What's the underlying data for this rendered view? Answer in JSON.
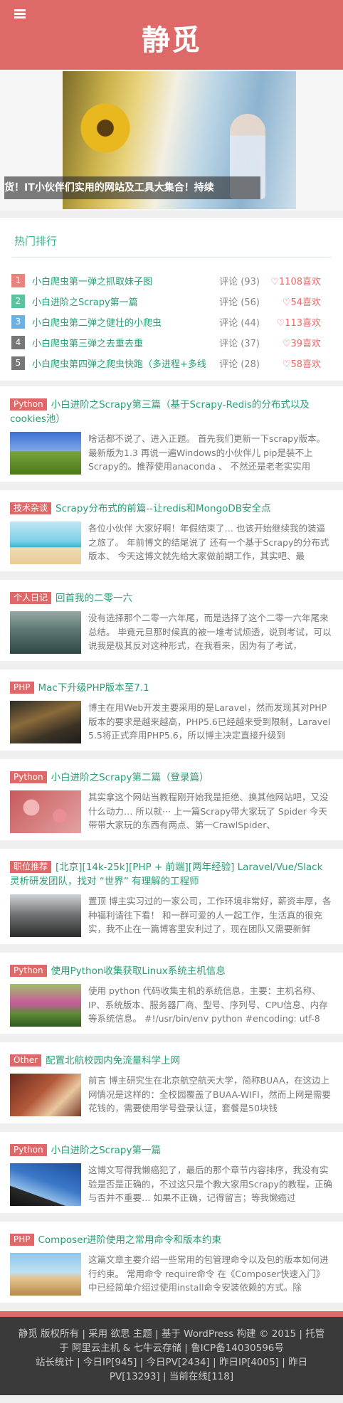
{
  "header": {
    "logo": "静觅",
    "menu_icon": "menu-icon"
  },
  "slider": {
    "caption": "干货！IT小伙伴们实用的网站及工具大集合！持续"
  },
  "hot": {
    "title": "热门排行",
    "items": [
      {
        "rank": "1",
        "color": "#e8837d",
        "title": "小白爬虫第一弹之抓取妹子图",
        "comments": "评论 (93)",
        "likes": "♡1108喜欢"
      },
      {
        "rank": "2",
        "color": "#5cc3a0",
        "title": "小白进阶之Scrapy第一篇",
        "comments": "评论 (56)",
        "likes": "♡54喜欢"
      },
      {
        "rank": "3",
        "color": "#6db0e2",
        "title": "小白爬虫第二弹之健壮的小爬虫",
        "comments": "评论 (44)",
        "likes": "♡113喜欢"
      },
      {
        "rank": "4",
        "color": "#777777",
        "title": "小白爬虫第三弹之去重去重",
        "comments": "评论 (37)",
        "likes": "♡39喜欢"
      },
      {
        "rank": "5",
        "color": "#777777",
        "title": "小白爬虫第四弹之爬虫快跑（多进程+多线",
        "comments": "评论 (28)",
        "likes": "♡58喜欢"
      }
    ]
  },
  "posts": [
    {
      "cat": "Python",
      "title": "小白进阶之Scrapy第三篇（基于Scrapy-Redis的分布式以及cookies池）",
      "excerpt": "啥话都不说了、进入正题。 首先我们更新一下scrapy版本。最新版为1.3 再说一遍Windows的小伙伴儿 pip是装不上Scrapy的。推荐使用anaconda 、 不然还是老老实实用",
      "thumb": "thumb-church"
    },
    {
      "cat": "技术杂谈",
      "title": "Scrapy分布式的前篇--让redis和MongoDB安全点",
      "excerpt": "各位小伙伴 大家好啊！年假结束了… 也该开始继续我的装逼之旅了。 年前博文的结尾说了 还有一个基于Scrapy的分布式版本、 今天这博文就先给大家做前期工作，其实吧、最",
      "thumb": "thumb-beach"
    },
    {
      "cat": "个人日记",
      "title": "回首我的二零一六",
      "excerpt": "没有选择那个二零一六年尾，而是选择了这个二零一六年尾来总结。 毕竟元旦那时候真的被一堆考试烦透，说到考试，可以说我是极其反对这种形式，在我看来，因为有了考试，",
      "thumb": "thumb-forest"
    },
    {
      "cat": "PHP",
      "title": "Mac下升级PHP版本至7.1",
      "excerpt": "博主在用Web开发主要采用的是Laravel，然而发现其对PHP版本的要求是越来越高，PHP5.6已经越来受到限制，Laravel 5.5将正式弃用PHP5.6，所以博主决定直接升级到",
      "thumb": "thumb-night"
    },
    {
      "cat": "Python",
      "title": "小白进阶之Scrapy第二篇（登录篇）",
      "excerpt": "其实拿这个网站当教程刚开始我是拒绝、换其他网站吧，又没什么动力… 所以就··· 上一篇Scrapy带大家玩了 Spider 今天带带大家玩的东西有两点、第一CrawlSpider、",
      "thumb": "thumb-flowers"
    },
    {
      "cat": "职位推荐",
      "title": "[北京][14k-25k][PHP + 前端][两年经验] Laravel/Vue/Slack 灵析研发团队，找对 “世界” 有理解的工程师",
      "excerpt": "置顶 博主实习过的一家公司，工作环境非常好，薪资丰厚，各种福利请往下看！ 和一群可爱的人一起工作，生活真的很充实，我不止在一篇博客里安利过了，现在团队又需要新鲜",
      "thumb": "thumb-team"
    },
    {
      "cat": "Python",
      "title": "使用Python收集获取Linux系统主机信息",
      "excerpt": "使用 python 代码收集主机的系统信息，主要：主机名称、IP、系统版本、服务器厂商、型号、序列号、CPU信息、内存等系统信息。 #!/usr/bin/env python #encoding: utf-8",
      "thumb": "thumb-garden"
    },
    {
      "cat": "Other",
      "title": "配置北航校园内免流量科学上网",
      "excerpt": "前言 博主研究生在北京航空航天大学，简称BUAA，在这边上网情况是这样的：全校园覆盖了BUAA-WIFI，然而上网是需要花钱的，需要使用学号登录认证，套餐是50块钱",
      "thumb": "thumb-room"
    },
    {
      "cat": "Python",
      "title": "小白进阶之Scrapy第一篇",
      "excerpt": "这博文写得我懒癌犯了，最后的那个章节内容排序，我没有实验是否是正确的，不过这只是个教大家用Scrapy的教程，正确与否并不重要… 如果不正确，记得留言；等我懒癌过",
      "thumb": "thumb-sky"
    },
    {
      "cat": "PHP",
      "title": "Composer进阶使用之常用命令和版本约束",
      "excerpt": "这篇文章主要介绍一些常用的包管理命令以及包的版本如何进行约束。 常用命令 require命令 在《Composer快速入门》中已经简单介绍过使用install命令安装依赖的方式。除",
      "thumb": "thumb-windmill"
    }
  ],
  "footer": {
    "line1": "静觅 版权所有 | 采用 欲思 主题 | 基于 WordPress 构建 © 2015 | 托管于 阿里云主机 & 七牛云存储 | 鲁ICP备14030596号",
    "line2": "站长统计 | 今日IP[945] | 今日PV[2434] | 昨日IP[4005] | 昨日PV[13293] | 当前在线[118]"
  }
}
